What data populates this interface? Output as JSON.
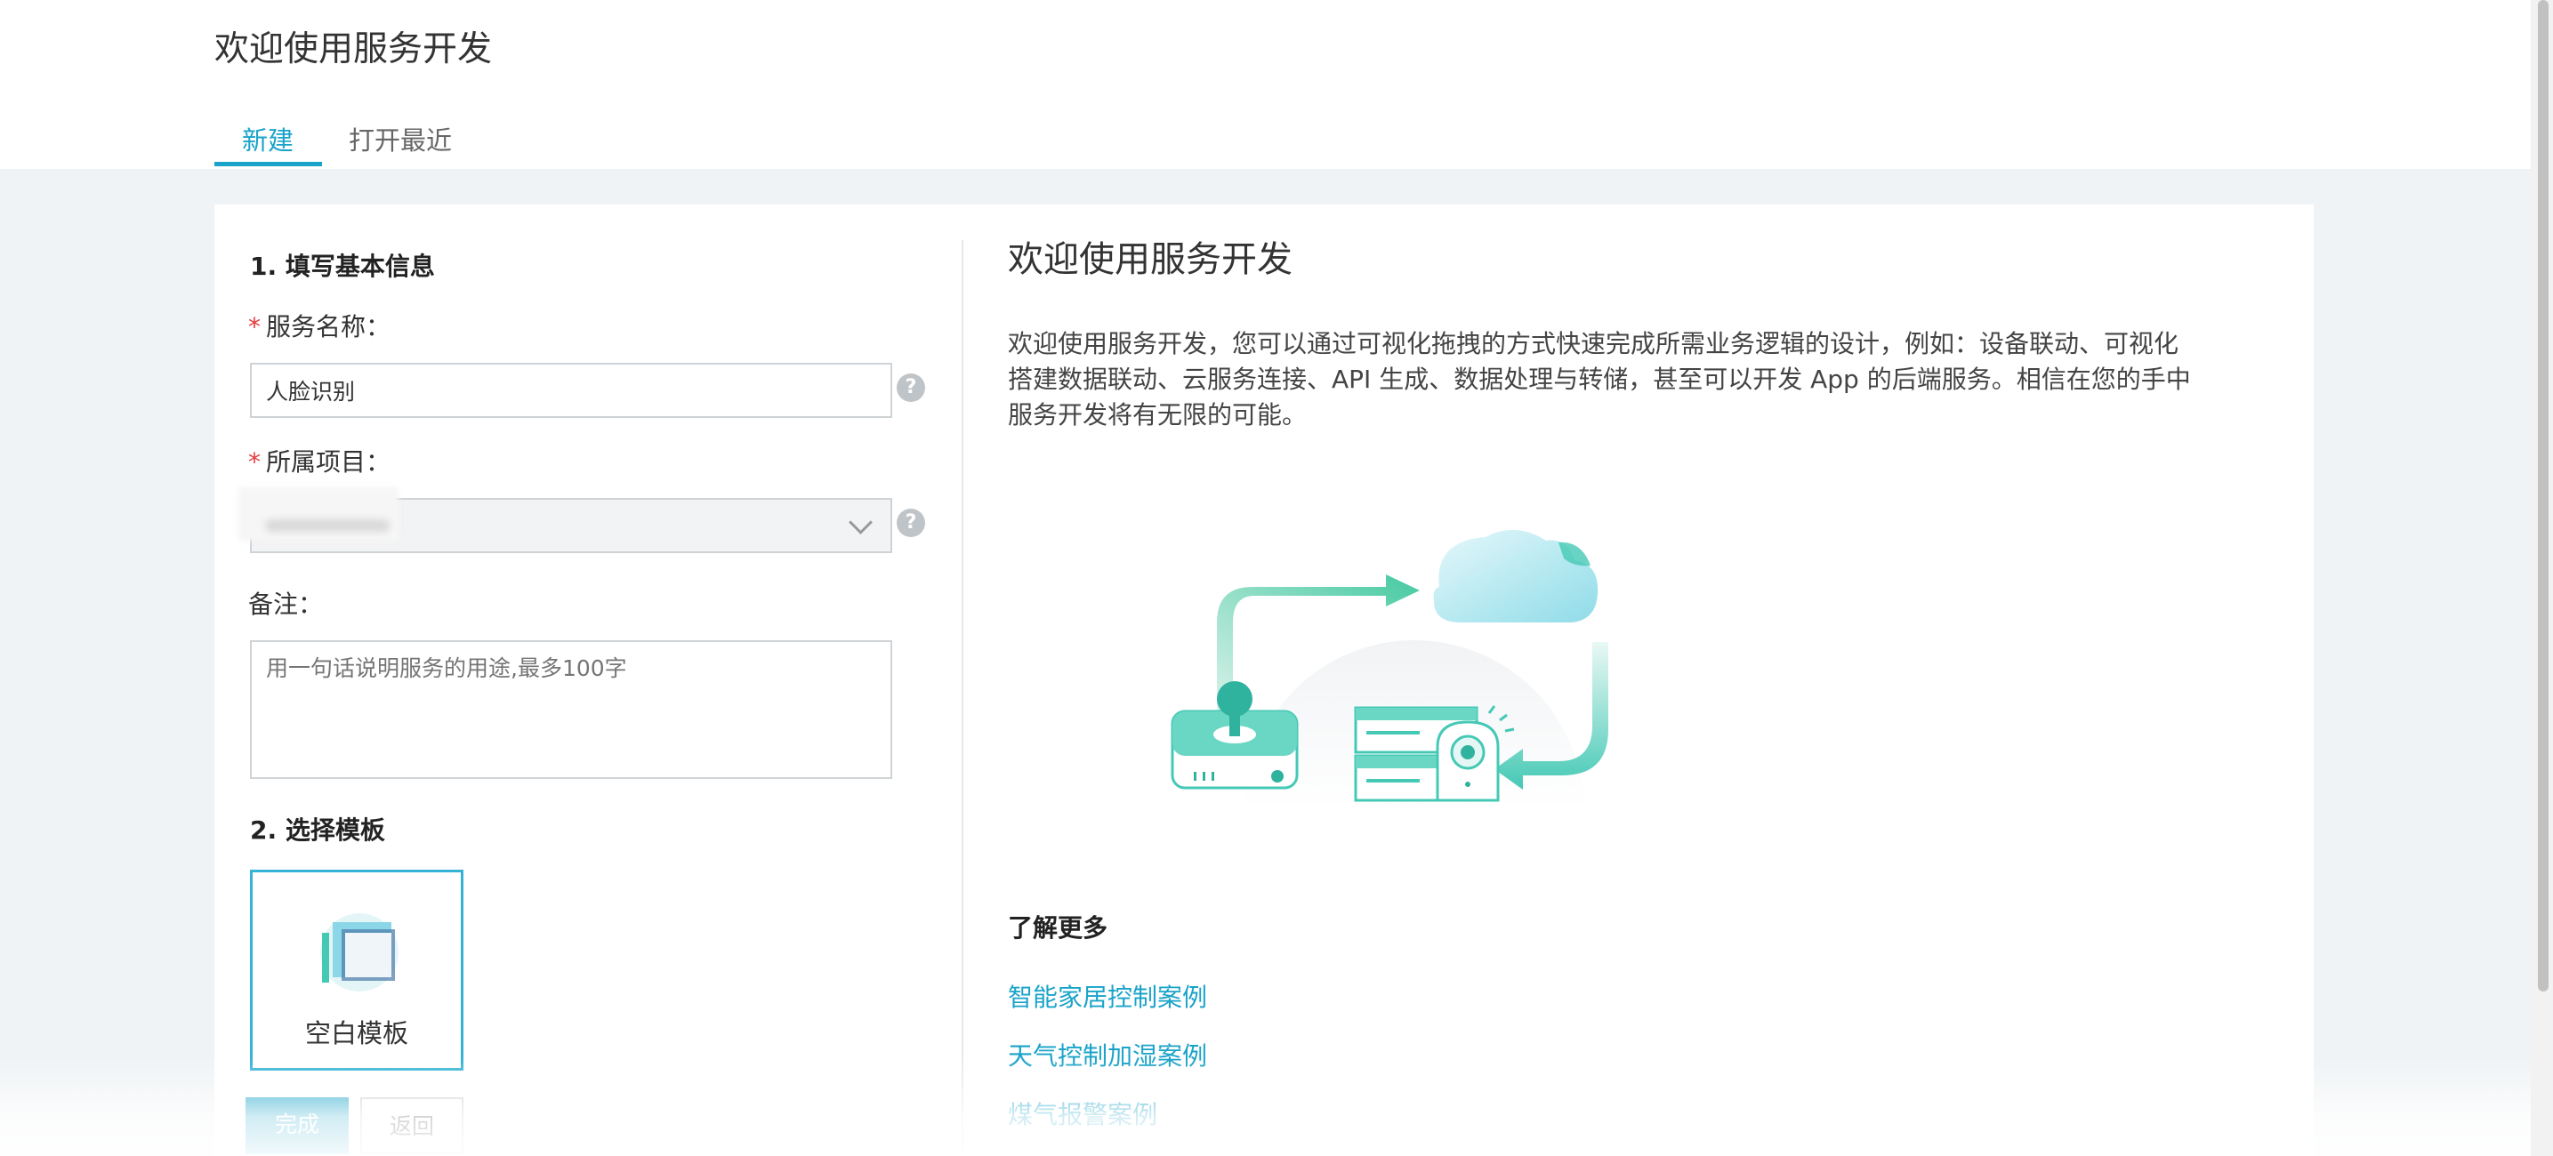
{
  "header": {
    "title": "欢迎使用服务开发",
    "tabs": [
      {
        "label": "新建",
        "active": true
      },
      {
        "label": "打开最近",
        "active": false
      }
    ]
  },
  "form": {
    "section1_title": "1. 填写基本信息",
    "service_name": {
      "required_mark": "*",
      "label": "服务名称：",
      "value": "人脸识别"
    },
    "project": {
      "required_mark": "*",
      "label": "所属项目：",
      "value": ""
    },
    "note": {
      "label": "备注：",
      "placeholder": "用一句话说明服务的用途,最多100字"
    },
    "help_glyph": "?",
    "section2_title": "2. 选择模板",
    "template": {
      "label": "空白模板",
      "selected": true
    }
  },
  "buttons": {
    "done": "完成",
    "back": "返回"
  },
  "intro": {
    "title": "欢迎使用服务开发",
    "description": "欢迎使用服务开发，您可以通过可视化拖拽的方式快速完成所需业务逻辑的设计，例如：设备联动、可视化搭建数据联动、云服务连接、API 生成、数据处理与转储，甚至可以开发 App 的后端服务。相信在您的手中服务开发将有无限的可能。",
    "learn_more": "了解更多",
    "links": [
      "智能家居控制案例",
      "天气控制加湿案例",
      "煤气报警案例"
    ]
  },
  "colors": {
    "accent": "#1aa3c9",
    "required": "#e4393c",
    "teal": "#45c9b5"
  }
}
